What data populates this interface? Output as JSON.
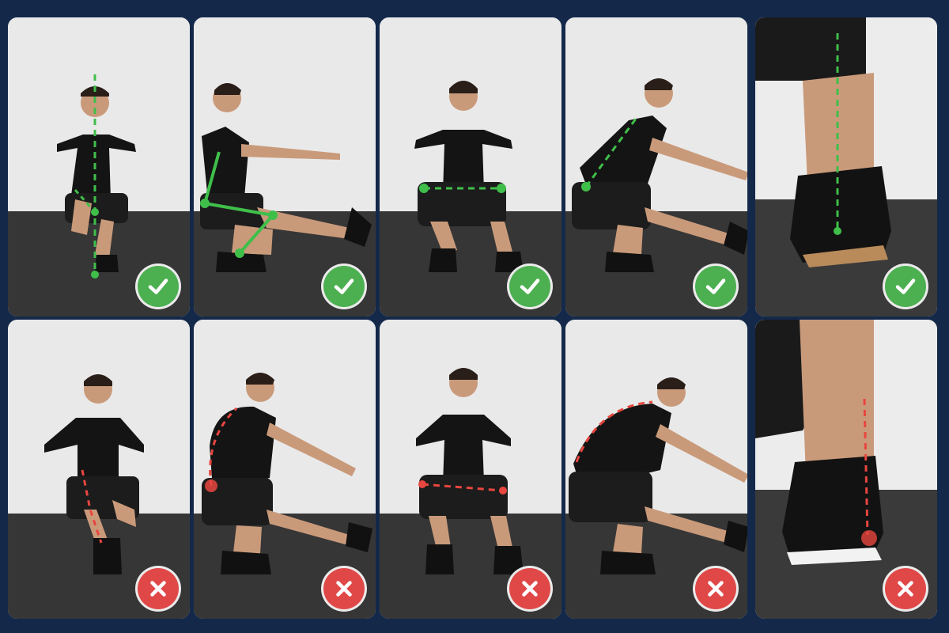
{
  "colors": {
    "background": "#14294a",
    "wall": "#e8e8e8",
    "floor": "#3a3a3a",
    "correct_overlay": "#3fbf4a",
    "wrong_overlay": "#e8463f",
    "check_badge": "#4caf50",
    "cross_badge": "#e04848"
  },
  "rows": [
    {
      "status": "correct",
      "badge_icon": "check-icon",
      "panels": [
        "front-balance-line",
        "side-hip-knee-angle",
        "front-level-hips",
        "side-neutral-spine",
        "heel-close-up"
      ]
    },
    {
      "status": "incorrect",
      "badge_icon": "cross-icon",
      "panels": [
        "front-knee-cave",
        "side-rounded-back",
        "front-tilted-hips",
        "side-excessive-lean",
        "heel-lift-close-up"
      ]
    }
  ]
}
